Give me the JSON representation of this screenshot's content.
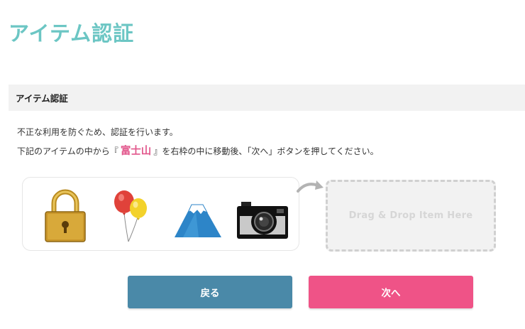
{
  "page": {
    "title": "アイテム認証"
  },
  "section": {
    "title": "アイテム認証"
  },
  "instructions": {
    "line1": "不正な利用を防ぐため、認証を行います。",
    "line2_prefix": "下記のアイテムの中から『",
    "target_item": "富士山",
    "line2_suffix": "』を右枠の中に移動後、「次へ」ボタンを押してください。"
  },
  "items": [
    {
      "icon": "padlock-icon"
    },
    {
      "icon": "balloons-icon"
    },
    {
      "icon": "mount-fuji-icon"
    },
    {
      "icon": "camera-icon"
    }
  ],
  "drop_zone": {
    "label": "Drag & Drop  Item Here"
  },
  "buttons": {
    "back_label": "戻る",
    "next_label": "次へ"
  },
  "colors": {
    "title": "#6cc6c4",
    "back_button": "#4a89a8",
    "next_button": "#ef5387",
    "target_text": "#e2578c"
  }
}
